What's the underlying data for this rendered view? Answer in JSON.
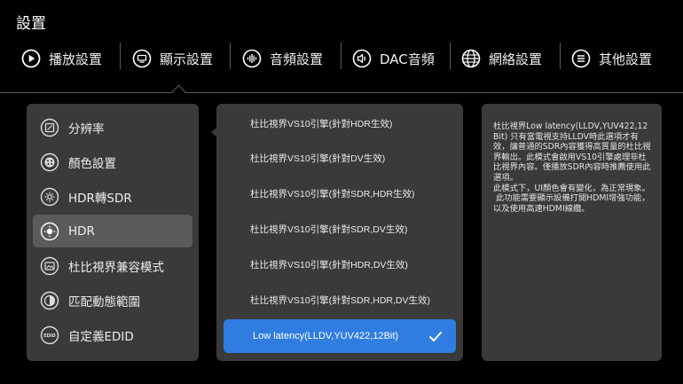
{
  "page": {
    "title": "設置"
  },
  "tabs": [
    {
      "label": "播放設置",
      "icon": "play-circle-icon"
    },
    {
      "label": "顯示設置",
      "icon": "monitor-icon"
    },
    {
      "label": "音頻設置",
      "icon": "audio-wave-icon"
    },
    {
      "label": "DAC音頻",
      "icon": "speaker-icon"
    },
    {
      "label": "網絡設置",
      "icon": "globe-icon"
    },
    {
      "label": "其他設置",
      "icon": "menu-circle-icon"
    }
  ],
  "sidebar": {
    "items": [
      {
        "label": "分辨率",
        "icon": "resolution-icon"
      },
      {
        "label": "顏色設置",
        "icon": "palette-icon"
      },
      {
        "label": "HDR轉SDR",
        "icon": "hdr-convert-icon"
      },
      {
        "label": "HDR",
        "icon": "hdr-icon"
      },
      {
        "label": "杜比視界兼容模式",
        "icon": "dolby-compat-icon"
      },
      {
        "label": "匹配動態範圍",
        "icon": "dynamic-range-icon"
      },
      {
        "label": "自定義EDID",
        "icon": "edid-icon"
      }
    ],
    "selected_index": 3
  },
  "options": {
    "items": [
      {
        "label": "杜比視界VS10引擎(針對HDR生效)"
      },
      {
        "label": "杜比視界VS10引擎(針對DV生效)"
      },
      {
        "label": "杜比視界VS10引擎(針對SDR,HDR生效)"
      },
      {
        "label": "杜比視界VS10引擎(針對SDR,DV生效)"
      },
      {
        "label": "杜比視界VS10引擎(針對HDR,DV生效)"
      },
      {
        "label": "杜比視界VS10引擎(針對SDR,HDR,DV生效)"
      },
      {
        "label": "Low latency(LLDV,YUV422,12Bit)"
      }
    ],
    "selected_index": 6
  },
  "description": {
    "text": "杜比視界Low latency(LLDV,YUV422,12Bit) 只有當電視支持LLDV時此選項才有效，讓普通的SDR內容獲得高質量的杜比視界輸出。此模式會啟用VS10引擎處理非杜比視界內容。僅播放SDR內容時推薦使用此選項。\n此模式下，UI顏色會有變化，為正常現象。\n 此功能需要顯示設備打開HDMI增強功能，以及使用高速HDMI線纜。"
  },
  "colors": {
    "background": "#000000",
    "panel": "#3a3a3a",
    "selected_menu": "#5b5b5b",
    "accent": "#2f7de1"
  }
}
